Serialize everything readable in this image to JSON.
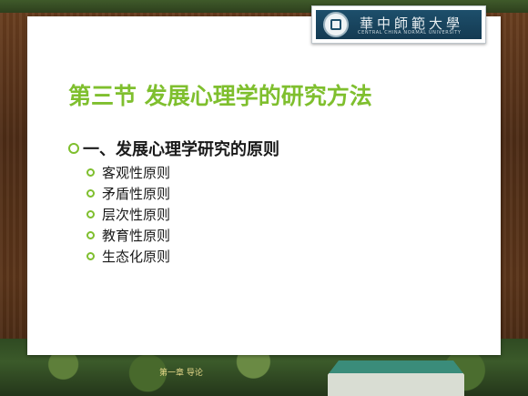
{
  "header": {
    "logo_cn": "華中師範大學",
    "logo_en": "CENTRAL CHINA NORMAL UNIVERSITY"
  },
  "slide": {
    "title": "第三节 发展心理学的研究方法",
    "section": "一、发展心理学研究的原则",
    "items": [
      "客观性原则",
      "矛盾性原则",
      "层次性原则",
      "教育性原则",
      "生态化原则"
    ]
  },
  "footer": {
    "text": "第一章 导论"
  },
  "colors": {
    "accent": "#7fbf2e",
    "text": "#1a1a1a",
    "wood": "#4a2d18"
  }
}
